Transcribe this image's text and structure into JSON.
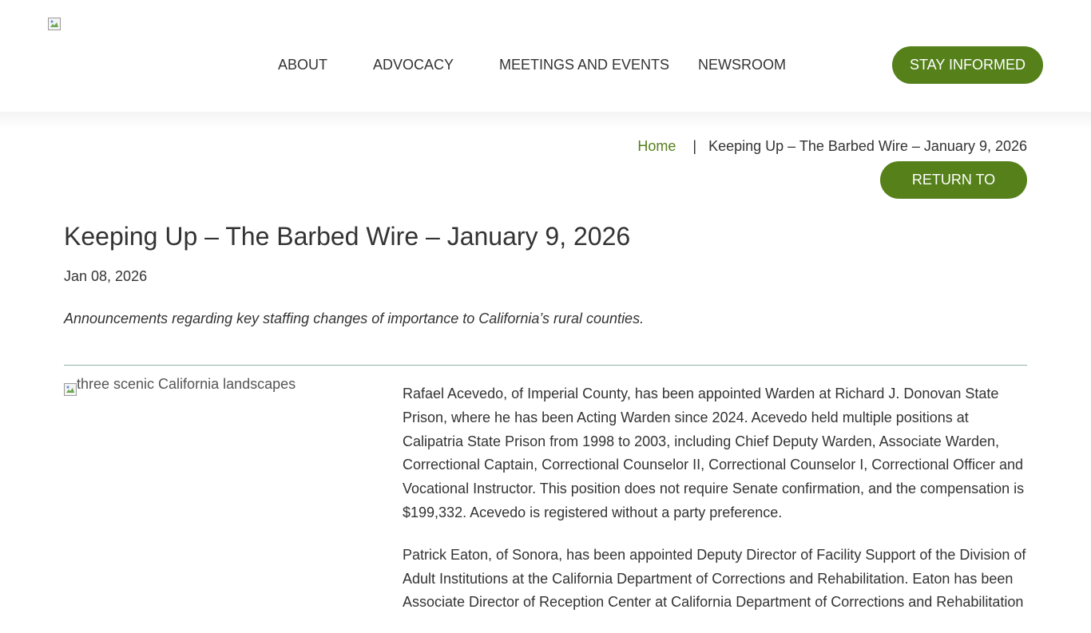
{
  "header": {
    "nav": [
      {
        "label": "ABOUT"
      },
      {
        "label": "ADVOCACY"
      },
      {
        "label": "MEETINGS AND EVENTS"
      },
      {
        "label": "NEWSROOM"
      }
    ],
    "cta_label": "STAY INFORMED"
  },
  "breadcrumb": {
    "home": "Home",
    "separator": "|",
    "current": "Keeping Up – The Barbed Wire – January 9, 2026"
  },
  "return_label": "RETURN TO",
  "article": {
    "title": "Keeping Up – The Barbed Wire – January 9, 2026",
    "date": "Jan 08, 2026",
    "summary": "Announcements regarding key staffing changes of importance to California’s rural counties.",
    "image_alt": "three scenic California landscapes",
    "paragraphs": [
      "Rafael Acevedo, of Imperial County, has been appointed Warden at Richard J. Donovan State Prison, where he has been Acting Warden since 2024. Acevedo held multiple positions at Calipatria State Prison from 1998 to 2003, including Chief Deputy Warden, Associate Warden, Correctional Captain, Correctional Counselor II, Correctional Counselor I, Correctional Officer and Vocational Instructor. This position does not require Senate confirmation, and the compensation is $199,332. Acevedo is registered without a party preference.",
      "Patrick Eaton, of Sonora, has been appointed Deputy Director of Facility Support of the Division of Adult Institutions at the California Department of Corrections and Rehabilitation. Eaton has been Associate Director of Reception Center at California Department of Corrections and Rehabilitation"
    ]
  },
  "colors": {
    "brand_green": "#55801a",
    "text": "#333333",
    "divider": "#8fb2a8"
  },
  "icons": {
    "logo": "broken-image-icon",
    "article_image": "broken-image-icon"
  }
}
